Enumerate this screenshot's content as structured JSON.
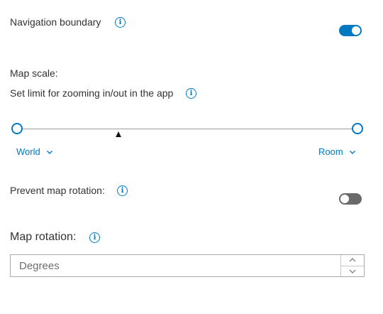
{
  "navigation_boundary": {
    "label": "Navigation boundary",
    "enabled": true,
    "icon": "info-icon"
  },
  "map_scale": {
    "label": "Map scale:",
    "description": "Set limit for zooming in/out in the app",
    "icon": "info-icon",
    "min_label": "World",
    "max_label": "Room"
  },
  "prevent_rotation": {
    "label": "Prevent map rotation:",
    "enabled": false,
    "icon": "info-icon"
  },
  "map_rotation": {
    "label": "Map rotation:",
    "placeholder": "Degrees",
    "icon": "info-icon"
  },
  "colors": {
    "accent": "#0079c1",
    "toggle_off": "#6a6a6a",
    "text": "#323232"
  }
}
